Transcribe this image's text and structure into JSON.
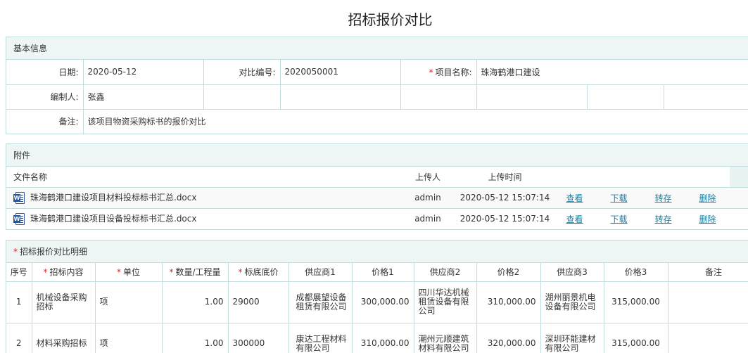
{
  "title": "招标报价对比",
  "basic": {
    "section_title": "基本信息",
    "date_label": "日期:",
    "date_value": "2020-05-12",
    "code_label": "对比编号:",
    "code_value": "2020050001",
    "project_required_mark": "*",
    "project_label": "项目名称:",
    "project_value": "珠海鹤港口建设",
    "editor_label": "编制人:",
    "editor_value": "张鑫",
    "remark_label": "备注:",
    "remark_value": "该项目物资采购标书的报价对比"
  },
  "attachments": {
    "section_title": "附件",
    "headers": {
      "name": "文件名称",
      "uploader": "上传人",
      "time": "上传时间"
    },
    "actions": {
      "view": "查看",
      "download": "下载",
      "save": "转存",
      "delete": "删除"
    },
    "icon": "word-document-icon",
    "files": [
      {
        "name": "珠海鹤港口建设项目材料投标标书汇总.docx",
        "uploader": "admin",
        "time": "2020-05-12 15:07:14"
      },
      {
        "name": "珠海鹤港口建设项目设备投标标书汇总.docx",
        "uploader": "admin",
        "time": "2020-05-12 15:07:14"
      }
    ]
  },
  "details": {
    "required_mark": "*",
    "section_title": "招标报价对比明细",
    "headers": {
      "no": "序号",
      "content": "招标内容",
      "unit": "单位",
      "qty": "数量/工程量",
      "base": "标底底价",
      "s1": "供应商1",
      "p1": "价格1",
      "s2": "供应商2",
      "p2": "价格2",
      "s3": "供应商3",
      "p3": "价格3",
      "remark": "备注"
    },
    "rows": [
      {
        "no": "1",
        "content": "机械设备采购招标",
        "unit": "项",
        "qty": "1.00",
        "base": "29000",
        "s1": "成都展望设备租赁有限公司",
        "p1": "300,000.00",
        "s2": "四川华达机械租赁设备有限公司",
        "p2": "310,000.00",
        "s3": "湖州丽景机电设备有限公司",
        "p3": "315,000.00",
        "remark": ""
      },
      {
        "no": "2",
        "content": "材料采购招标",
        "unit": "项",
        "qty": "1.00",
        "base": "300000",
        "s1": "康达工程材料有限公司",
        "p1": "310,000.00",
        "s2": "潮州元顺建筑材料有限公司",
        "p2": "320,000.00",
        "s3": "深圳环能建材有限公司",
        "p3": "315,000.00",
        "remark": ""
      }
    ]
  },
  "colors": {
    "border": "#c2dddd",
    "header_bg": "#eef5f5",
    "link": "#1c7fa0",
    "required": "#e02020",
    "word_blue": "#2b579a"
  }
}
